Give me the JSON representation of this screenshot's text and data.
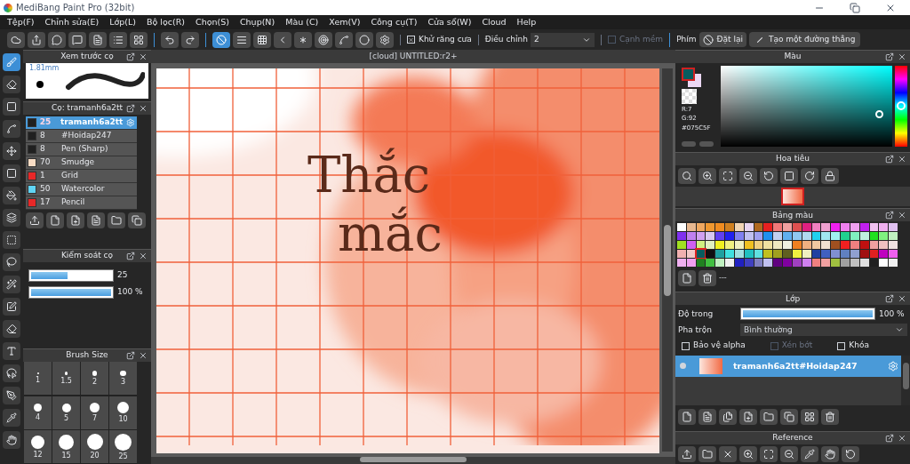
{
  "window": {
    "title": "MediBang Paint Pro (32bit)"
  },
  "menu": [
    "Tệp(F)",
    "Chỉnh sửa(E)",
    "Lớp(L)",
    "Bộ lọc(R)",
    "Chọn(S)",
    "Chụp(N)",
    "Màu (C)",
    "Xem(V)",
    "Công cụ(T)",
    "Cửa sổ(W)",
    "Cloud",
    "Help"
  ],
  "toolbar": {
    "snap_tools": [
      {
        "kind": "none",
        "selected": true
      },
      {
        "kind": "parallel",
        "selected": false
      },
      {
        "kind": "grid",
        "selected": false
      },
      {
        "kind": "vanish",
        "selected": false
      },
      {
        "kind": "radial",
        "selected": false
      },
      {
        "kind": "concentric",
        "selected": false
      },
      {
        "kind": "curve",
        "selected": false
      },
      {
        "kind": "circle",
        "selected": false
      },
      {
        "kind": "settings",
        "selected": false
      }
    ],
    "antialias": {
      "label": "Khử răng cưa",
      "checked": true
    },
    "correction": {
      "label": "Điều chỉnh",
      "value": "2"
    },
    "soft_edge": {
      "label": "Cạnh mềm",
      "checked": false
    },
    "keys_label": "Phím",
    "reset_button": "Đặt lại",
    "line_button": "Tạo một đường thẳng"
  },
  "tools": [
    {
      "kind": "brush",
      "selected": true
    },
    {
      "kind": "eraser",
      "selected": false
    },
    {
      "kind": "rect",
      "selected": false
    },
    {
      "kind": "spline",
      "selected": false
    },
    {
      "kind": "move",
      "selected": false
    },
    {
      "kind": "fill",
      "selected": false
    },
    {
      "kind": "bucket",
      "selected": false
    },
    {
      "kind": "gradient",
      "selected": false
    },
    {
      "kind": "select",
      "selected": false
    },
    {
      "kind": "lasso",
      "selected": false
    },
    {
      "kind": "wand",
      "selected": false
    },
    {
      "kind": "selectpen",
      "selected": false
    },
    {
      "kind": "selecteraser",
      "selected": false
    },
    {
      "kind": "text",
      "selected": false
    },
    {
      "kind": "operation",
      "selected": false
    },
    {
      "kind": "pen",
      "selected": false
    },
    {
      "kind": "dropper",
      "selected": false
    },
    {
      "kind": "hand",
      "selected": false
    }
  ],
  "brush_preview": {
    "title": "Xem trước cọ",
    "size": "1.81mm"
  },
  "brushes": {
    "title": "Cọ: tramanh6a2tt",
    "items": [
      {
        "color": "#202020",
        "size": "25",
        "name": "tramanh6a2tt",
        "selected": true
      },
      {
        "color": "#202020",
        "size": "8",
        "name": "#Hoidap247",
        "selected": false
      },
      {
        "color": "#202020",
        "size": "8",
        "name": "Pen (Sharp)",
        "selected": false
      },
      {
        "color": "#f8dcc4",
        "size": "70",
        "name": "Smudge",
        "selected": false
      },
      {
        "color": "#e82828",
        "size": "1",
        "name": "Grid",
        "selected": false
      },
      {
        "color": "#60d4f4",
        "size": "50",
        "name": "Watercolor",
        "selected": false
      },
      {
        "color": "#e82828",
        "size": "17",
        "name": "Pencil",
        "selected": false
      }
    ]
  },
  "brush_control": {
    "title": "Kiểm soát cọ",
    "size": {
      "level": 0.46,
      "reading": "25"
    },
    "opacity": {
      "level": 1,
      "reading": "100 %"
    }
  },
  "brush_size": {
    "title": "Brush Size",
    "sizes": [
      "1",
      "1.5",
      "2",
      "3",
      "4",
      "5",
      "7",
      "10",
      "12",
      "15",
      "20",
      "25"
    ]
  },
  "canvas": {
    "tab": "[cloud] UNTITLED:r2+",
    "lines": [
      "Thắc",
      "mắc"
    ]
  },
  "color": {
    "title": "Màu",
    "readings": [
      "R:7",
      "G:92"
    ],
    "hex": "#075C5F"
  },
  "navigator": {
    "title": "Hoa tiêu"
  },
  "palette": {
    "title": "Bảng màu",
    "footer": "---",
    "rows": [
      [
        {
          "color": "#ffffff",
          "selected": false
        },
        {
          "color": "#e8b890",
          "selected": false
        },
        {
          "color": "#f0a860",
          "selected": false
        },
        {
          "color": "#f09830",
          "selected": false
        },
        {
          "color": "#f08c20",
          "selected": false
        },
        {
          "color": "#d08020",
          "selected": false
        },
        {
          "color": "#f0d4b4",
          "selected": false
        },
        {
          "color": "#e8d4f0",
          "selected": false
        },
        {
          "color": "#b06820",
          "selected": false
        },
        {
          "color": "#e82020",
          "selected": false
        },
        {
          "color": "#f07878",
          "selected": false
        },
        {
          "color": "#f0a0a0",
          "selected": false
        },
        {
          "color": "#e05050",
          "selected": false
        },
        {
          "color": "#e02080",
          "selected": false
        },
        {
          "color": "#f080c0",
          "selected": false
        },
        {
          "color": "#f0a0d0",
          "selected": false
        },
        {
          "color": "#f020f0",
          "selected": false
        },
        {
          "color": "#f080f0",
          "selected": false
        },
        {
          "color": "#f0a0f0",
          "selected": false
        },
        {
          "color": "#c020f0",
          "selected": false
        },
        {
          "color": "#f0c0f0",
          "selected": false
        },
        {
          "color": "#f0b0f0",
          "selected": false
        },
        {
          "color": "#e0c0f0",
          "selected": false
        }
      ],
      [
        {
          "color": "#8030f0",
          "selected": false
        },
        {
          "color": "#c080f0",
          "selected": false
        },
        {
          "color": "#d0a0f0",
          "selected": false
        },
        {
          "color": "#d8c8f0",
          "selected": false
        },
        {
          "color": "#6040f0",
          "selected": false
        },
        {
          "color": "#2020f0",
          "selected": false
        },
        {
          "color": "#8080f0",
          "selected": false
        },
        {
          "color": "#c0c0f0",
          "selected": false
        },
        {
          "color": "#a0a0f0",
          "selected": false
        },
        {
          "color": "#2090f0",
          "selected": false
        },
        {
          "color": "#c0d0f0",
          "selected": false
        },
        {
          "color": "#60b0f0",
          "selected": false
        },
        {
          "color": "#90c8f0",
          "selected": false
        },
        {
          "color": "#b0d8f0",
          "selected": false
        },
        {
          "color": "#20d0f0",
          "selected": false
        },
        {
          "color": "#a0e8f0",
          "selected": false
        },
        {
          "color": "#a0f0f0",
          "selected": false
        },
        {
          "color": "#20d090",
          "selected": false
        },
        {
          "color": "#80f0c0",
          "selected": false
        },
        {
          "color": "#c0f0e0",
          "selected": false
        },
        {
          "color": "#20e020",
          "selected": false
        },
        {
          "color": "#80f080",
          "selected": false
        },
        {
          "color": "#c0f0c0",
          "selected": false
        }
      ],
      [
        {
          "color": "#a0e020",
          "selected": false
        },
        {
          "color": "#d060f0",
          "selected": false
        },
        {
          "color": "#d0f080",
          "selected": false
        },
        {
          "color": "#e0f0c0",
          "selected": false
        },
        {
          "color": "#f0f020",
          "selected": false
        },
        {
          "color": "#f0f080",
          "selected": false
        },
        {
          "color": "#f0f0c0",
          "selected": false
        },
        {
          "color": "#f0c020",
          "selected": false
        },
        {
          "color": "#f0d080",
          "selected": false
        },
        {
          "color": "#f0e0a0",
          "selected": false
        },
        {
          "color": "#f0e8c0",
          "selected": false
        },
        {
          "color": "#f0f0e0",
          "selected": false
        },
        {
          "color": "#f08020",
          "selected": false
        },
        {
          "color": "#f0b080",
          "selected": false
        },
        {
          "color": "#f0c8a0",
          "selected": false
        },
        {
          "color": "#f0e0d0",
          "selected": false
        },
        {
          "color": "#a05020",
          "selected": false
        },
        {
          "color": "#f02020",
          "selected": false
        },
        {
          "color": "#f08080",
          "selected": false
        },
        {
          "color": "#c01010",
          "selected": false
        },
        {
          "color": "#f0a0a0",
          "selected": false
        },
        {
          "color": "#f0c0c0",
          "selected": false
        },
        {
          "color": "#f0e0e0",
          "selected": false
        }
      ],
      [
        {
          "color": "#f0b0b0",
          "selected": false
        },
        {
          "color": "#f0c8c8",
          "selected": false
        },
        {
          "color": "#075c5f",
          "selected": true
        },
        {
          "color": "#101010",
          "selected": false
        },
        {
          "color": "#20a0a0",
          "selected": false
        },
        {
          "color": "#40e0e0",
          "selected": false
        },
        {
          "color": "#a0e0e0",
          "selected": false
        },
        {
          "color": "#20c0c0",
          "selected": false
        },
        {
          "color": "#60e0e0",
          "selected": false
        },
        {
          "color": "#c0c020",
          "selected": false
        },
        {
          "color": "#a0a020",
          "selected": false
        },
        {
          "color": "#606020",
          "selected": false
        },
        {
          "color": "#f0f040",
          "selected": false
        },
        {
          "color": "#f0f0c0",
          "selected": false
        },
        {
          "color": "#2040a0",
          "selected": false
        },
        {
          "color": "#4060c0",
          "selected": false
        },
        {
          "color": "#8090d0",
          "selected": false
        },
        {
          "color": "#6080c0",
          "selected": false
        },
        {
          "color": "#90a0d0",
          "selected": false
        },
        {
          "color": "#a01010",
          "selected": false
        },
        {
          "color": "#e02020",
          "selected": false
        },
        {
          "color": "#c000c0",
          "selected": false
        },
        {
          "color": "#f060f0",
          "selected": false
        }
      ],
      [
        {
          "color": "#f0b0f0",
          "selected": false
        },
        {
          "color": "#f0a0f0",
          "selected": false
        },
        {
          "color": "#208020",
          "selected": false
        },
        {
          "color": "#40c040",
          "selected": false
        },
        {
          "color": "#c0f0c0",
          "selected": false
        },
        {
          "color": "#f0f0f0",
          "selected": false
        },
        {
          "color": "#2020c0",
          "selected": false
        },
        {
          "color": "#4040c0",
          "selected": false
        },
        {
          "color": "#8080c0",
          "selected": false
        },
        {
          "color": "#c0c0f0",
          "selected": false
        },
        {
          "color": "#600080",
          "selected": false
        },
        {
          "color": "#8000a0",
          "selected": false
        },
        {
          "color": "#a040c0",
          "selected": false
        },
        {
          "color": "#d080f0",
          "selected": false
        },
        {
          "color": "#f08080",
          "selected": false
        },
        {
          "color": "#f0a0a0",
          "selected": false
        },
        {
          "color": "#a0c040",
          "selected": false
        },
        {
          "color": "#a0a0a0",
          "selected": false
        },
        {
          "color": "#c0c0c0",
          "selected": false
        },
        {
          "color": "#e0e0e0",
          "selected": false
        },
        {
          "color": "#202020",
          "selected": false
        },
        {
          "color": "#ffffff",
          "selected": false
        },
        {
          "color": "#f0f0f0",
          "selected": false
        }
      ]
    ]
  },
  "layers": {
    "title": "Lớp",
    "opacity": {
      "label": "Độ trong",
      "level": 1,
      "reading": "100 %"
    },
    "blend": {
      "label": "Pha trộn",
      "value": "Bình thường"
    },
    "options": [
      {
        "label": "Bảo vệ alpha",
        "checked": false,
        "disabled": false
      },
      {
        "label": "Xén bớt",
        "checked": false,
        "disabled": true
      },
      {
        "label": "Khóa",
        "checked": false,
        "disabled": false
      }
    ],
    "items": [
      {
        "name": "tramanh6a2tt#Hoidap247",
        "selected": true
      }
    ]
  },
  "reference": {
    "title": "Reference"
  }
}
